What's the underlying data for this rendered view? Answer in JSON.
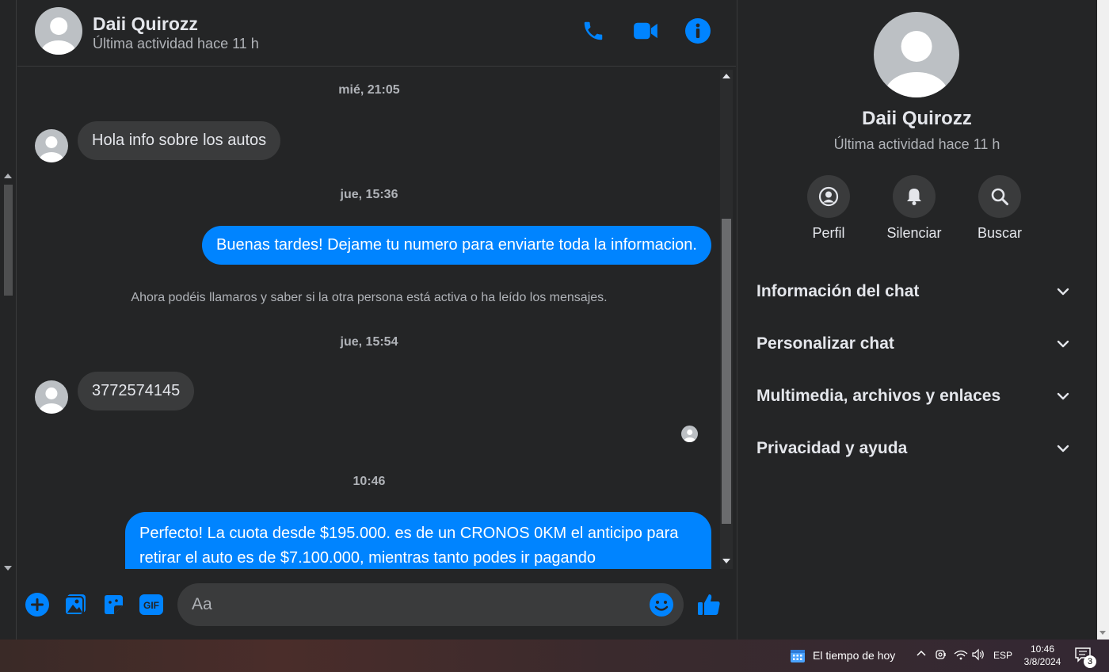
{
  "contact": {
    "name": "Daii Quirozz",
    "status": "Última actividad hace 11 h"
  },
  "header_icons": [
    "phone-icon",
    "video-icon",
    "info-icon"
  ],
  "messages": [
    {
      "type": "timestamp",
      "text": "mié, 21:05"
    },
    {
      "type": "incoming",
      "text": "Hola info sobre los autos"
    },
    {
      "type": "timestamp",
      "text": "jue, 15:36"
    },
    {
      "type": "outgoing",
      "text": "Buenas tardes! Dejame tu numero para enviarte toda la informacion."
    },
    {
      "type": "system",
      "text": "Ahora podéis llamaros y saber si la otra persona está activa o ha leído los mensajes."
    },
    {
      "type": "timestamp",
      "text": "jue, 15:54"
    },
    {
      "type": "incoming",
      "text": "3772574145"
    },
    {
      "type": "timestamp",
      "text": "10:46"
    },
    {
      "type": "outgoing",
      "text": "Perfecto! La cuota desde $195.000. es de un CRONOS 0KM el anticipo para retirar el auto es de $7.100.000, mientras tanto podes ir pagando"
    }
  ],
  "composer": {
    "placeholder": "Aa",
    "icons": [
      "plus-icon",
      "image-icon",
      "sticker-icon",
      "gif-icon",
      "emoji-icon",
      "like-icon"
    ],
    "gif_label": "GIF"
  },
  "panel": {
    "name": "Daii Quirozz",
    "status": "Última actividad hace 11 h",
    "actions": [
      {
        "label": "Perfil",
        "icon": "profile-icon"
      },
      {
        "label": "Silenciar",
        "icon": "bell-icon"
      },
      {
        "label": "Buscar",
        "icon": "search-icon"
      }
    ],
    "sections": [
      "Información del chat",
      "Personalizar chat",
      "Multimedia, archivos y enlaces",
      "Privacidad y ayuda"
    ]
  },
  "taskbar": {
    "weather": "El tiempo de hoy",
    "language": "ESP",
    "time": "10:46",
    "date": "3/8/2024",
    "notifications": "3"
  },
  "colors": {
    "accent": "#0084ff",
    "background": "#242526",
    "bubble_in": "#3a3b3c"
  }
}
